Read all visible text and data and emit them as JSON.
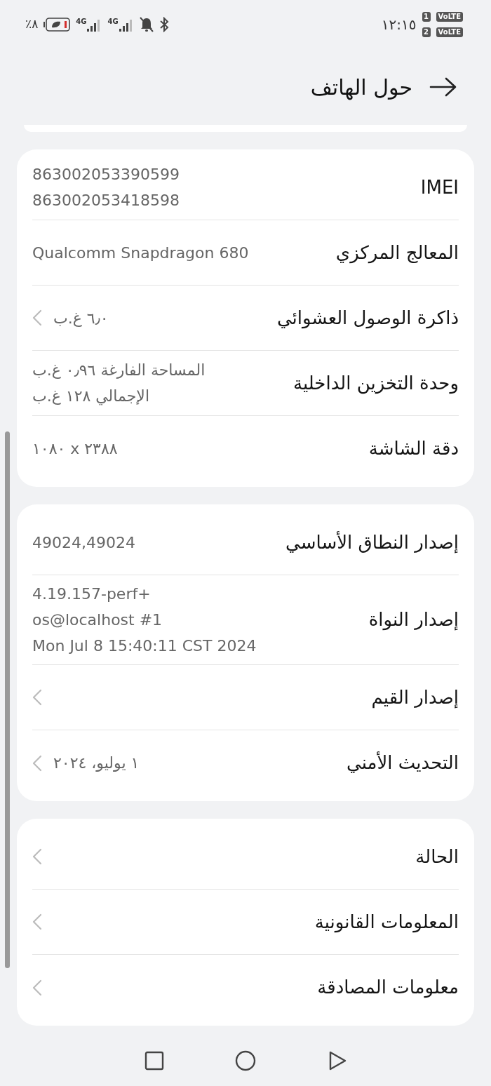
{
  "status_bar": {
    "battery_percent": "٨٪",
    "network_1": "4G",
    "network_2": "4G",
    "time": "١٢:١٥",
    "sims": [
      {
        "slot": "1",
        "badge": "VoLTE"
      },
      {
        "slot": "2",
        "badge": "VoLTE"
      }
    ]
  },
  "header": {
    "title": "حول الهاتف"
  },
  "sections": [
    {
      "rows": [
        {
          "label": "IMEI",
          "values": [
            "863002053390599",
            "863002053418598"
          ],
          "chevron": false
        },
        {
          "label": "المعالج المركزي",
          "values": [
            "Qualcomm Snapdragon 680"
          ],
          "chevron": false
        },
        {
          "label": "ذاكرة الوصول العشوائي",
          "values": [
            "٦٫٠ غ.ب"
          ],
          "chevron": true
        },
        {
          "label": "وحدة التخزين الداخلية",
          "values": [
            "المساحة الفارغة ٠٫٩٦  غ.ب",
            "الإجمالي ١٢٨  غ.ب"
          ],
          "chevron": false
        },
        {
          "label": "دقة الشاشة",
          "values": [
            "٢٣٨٨ x ١٠٨٠"
          ],
          "chevron": false
        }
      ]
    },
    {
      "rows": [
        {
          "label": "إصدار النطاق الأساسي",
          "values": [
            "49024,49024"
          ],
          "chevron": false
        },
        {
          "label": "إصدار النواة",
          "values": [
            "4.19.157-perf+",
            "os@localhost #1",
            "Mon Jul 8 15:40:11 CST 2024"
          ],
          "chevron": false
        },
        {
          "label": "إصدار القيم",
          "values": [],
          "chevron": true
        },
        {
          "label": "التحديث الأمني",
          "values": [
            "١ يوليو، ٢٠٢٤"
          ],
          "chevron": true
        }
      ]
    },
    {
      "rows": [
        {
          "label": "الحالة",
          "values": [],
          "chevron": true
        },
        {
          "label": "المعلومات القانونية",
          "values": [],
          "chevron": true
        },
        {
          "label": "معلومات المصادقة",
          "values": [],
          "chevron": true
        }
      ]
    }
  ]
}
